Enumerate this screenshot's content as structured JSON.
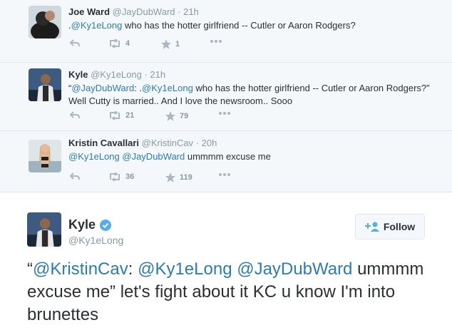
{
  "tweets": [
    {
      "name": "Joe Ward",
      "handle": "@JayDubWard",
      "time": "21h",
      "text_prefix": ".",
      "mention1": "@Ky1eLong",
      "text_rest": " who has the hotter girlfriend -- Cutler or Aaron Rodgers?",
      "retweets": "4",
      "favorites": "1"
    },
    {
      "name": "Kyle",
      "handle": "@Ky1eLong",
      "time": "21h",
      "text_prefix": "“",
      "mention1": "@JayDubWard",
      "text_mid": ": .",
      "mention2": "@Ky1eLong",
      "text_rest": " who has the hotter girlfriend -- Cutler or Aaron Rodgers?” Well Cutty is married.. And I love the newsroom.. Sooo",
      "retweets": "21",
      "favorites": "79"
    },
    {
      "name": "Kristin Cavallari",
      "handle": "@KristinCav",
      "time": "20h",
      "mention1": "@Ky1eLong",
      "mention2": "@JayDubWard",
      "text_rest": " ummmm excuse me",
      "retweets": "36",
      "favorites": "119"
    }
  ],
  "featured": {
    "name": "Kyle",
    "handle": "@Ky1eLong",
    "follow_label": "Follow",
    "quote_open": "“",
    "mention1": "@KristinCav",
    "sep1": ": ",
    "mention2": "@Ky1eLong",
    "mention3": "@JayDubWard",
    "text_rest": " ummmm excuse me” let's fight about it KC u know I'm into brunettes"
  },
  "colors": {
    "link": "#2b7bb9",
    "muted": "#8899a6",
    "verified": "#55acee"
  }
}
